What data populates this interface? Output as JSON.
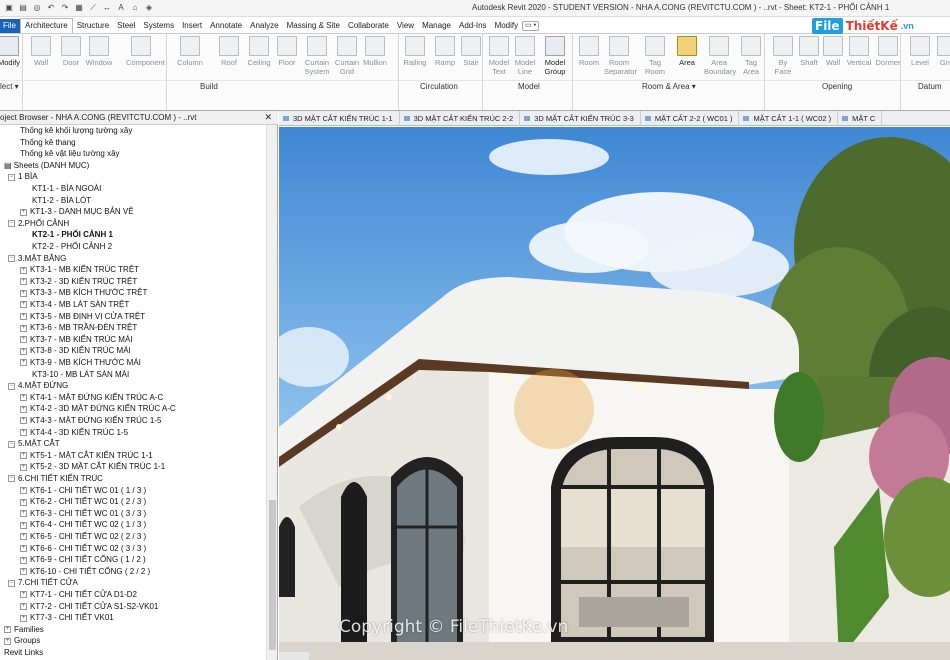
{
  "window": {
    "title": "Autodesk Revit 2020 - STUDENT VERSION - NHA A.CONG (REVITCTU.COM ) - ..rvt - Sheet: KT2-1 - PHỐI CẢNH 1"
  },
  "logo": {
    "file": "File",
    "name": "ThiếtKế",
    "vn": ".vn"
  },
  "ribbon_tabs": [
    {
      "label": "File"
    },
    {
      "label": "Architecture"
    },
    {
      "label": "Structure"
    },
    {
      "label": "Steel"
    },
    {
      "label": "Systems"
    },
    {
      "label": "Insert"
    },
    {
      "label": "Annotate"
    },
    {
      "label": "Analyze"
    },
    {
      "label": "Massing & Site"
    },
    {
      "label": "Collaborate"
    },
    {
      "label": "View"
    },
    {
      "label": "Manage"
    },
    {
      "label": "Add-Ins"
    },
    {
      "label": "Modify"
    },
    {
      "label": "▭ •"
    }
  ],
  "ribbon": {
    "tools": [
      {
        "l1": "Modify",
        "l2": "",
        "dark": true
      },
      {
        "l1": "Wall",
        "l2": ""
      },
      {
        "l1": "Door",
        "l2": ""
      },
      {
        "l1": "Window",
        "l2": ""
      },
      {
        "l1": "Component",
        "l2": ""
      },
      {
        "l1": "Column",
        "l2": ""
      },
      {
        "l1": "Roof",
        "l2": ""
      },
      {
        "l1": "Ceiling",
        "l2": ""
      },
      {
        "l1": "Floor",
        "l2": ""
      },
      {
        "l1": "Curtain",
        "l2": "System"
      },
      {
        "l1": "Curtain",
        "l2": "Grid"
      },
      {
        "l1": "Mullion",
        "l2": ""
      },
      {
        "l1": "Railing",
        "l2": ""
      },
      {
        "l1": "Ramp",
        "l2": ""
      },
      {
        "l1": "Stair",
        "l2": ""
      },
      {
        "l1": "Model",
        "l2": "Text"
      },
      {
        "l1": "Model",
        "l2": "Line"
      },
      {
        "l1": "Model",
        "l2": "Group",
        "dark": true
      },
      {
        "l1": "Room",
        "l2": ""
      },
      {
        "l1": "Room",
        "l2": "Separator"
      },
      {
        "l1": "Tag",
        "l2": "Room"
      },
      {
        "l1": "Area",
        "l2": "",
        "dark": true
      },
      {
        "l1": "Area",
        "l2": "Boundary"
      },
      {
        "l1": "Tag",
        "l2": "Area"
      },
      {
        "l1": "By",
        "l2": "Face"
      },
      {
        "l1": "Shaft",
        "l2": ""
      },
      {
        "l1": "Wall",
        "l2": ""
      },
      {
        "l1": "Vertical",
        "l2": ""
      },
      {
        "l1": "Dormer",
        "l2": ""
      },
      {
        "l1": "Level",
        "l2": ""
      },
      {
        "l1": "Grid",
        "l2": ""
      }
    ],
    "panels": [
      {
        "label": "lect ▾"
      },
      {
        "label": "Build"
      },
      {
        "label": "Circulation"
      },
      {
        "label": "Model"
      },
      {
        "label": "Room & Area ▾"
      },
      {
        "label": "Opening"
      },
      {
        "label": "Datum"
      }
    ]
  },
  "browser": {
    "title": "oject Browser - NHA A.CONG (REVITCTU.COM ) - ..rvt",
    "close": "✕",
    "rows": [
      {
        "text": "Thống kê khối lượng tường xây",
        "indent": 20,
        "exp": ""
      },
      {
        "text": "Thống kê thang",
        "indent": 20,
        "exp": ""
      },
      {
        "text": "Thống kê vật liệu tường xây",
        "indent": 20,
        "exp": ""
      },
      {
        "text": "Sheets (DANH MỤC)",
        "indent": 4,
        "exp": "",
        "icon": true
      },
      {
        "text": "1 BÌA",
        "indent": 8,
        "exp": "−"
      },
      {
        "text": "KT1-1 - BÌA NGOÀI",
        "indent": 32,
        "exp": ""
      },
      {
        "text": "KT1-2 - BÌA LÓT",
        "indent": 32,
        "exp": ""
      },
      {
        "text": "KT1-3 - DANH MỤC BẢN VẼ",
        "indent": 20,
        "exp": "+"
      },
      {
        "text": "2.PHỐI CẢNH",
        "indent": 8,
        "exp": "−"
      },
      {
        "text": "KT2-1 - PHỐI CẢNH 1",
        "indent": 32,
        "exp": "",
        "sel": true
      },
      {
        "text": "KT2-2 - PHỐI CẢNH 2",
        "indent": 32,
        "exp": ""
      },
      {
        "text": "3.MẶT BẰNG",
        "indent": 8,
        "exp": "−"
      },
      {
        "text": "KT3-1 - MB KIẾN TRÚC TRỆT",
        "indent": 20,
        "exp": "+"
      },
      {
        "text": "KT3-2 - 3D KIẾN TRÚC TRỆT",
        "indent": 20,
        "exp": "+"
      },
      {
        "text": "KT3-3 - MB KÍCH THƯỚC TRỆT",
        "indent": 20,
        "exp": "+"
      },
      {
        "text": "KT3-4 - MB LÁT SÀN TRỆT",
        "indent": 20,
        "exp": "+"
      },
      {
        "text": "KT3-5 - MB ĐỊNH VỊ CỬA TRỆT",
        "indent": 20,
        "exp": "+"
      },
      {
        "text": "KT3-6 - MB TRẦN-ĐÈN TRỆT",
        "indent": 20,
        "exp": "+"
      },
      {
        "text": "KT3-7 - MB KIẾN TRÚC MÁI",
        "indent": 20,
        "exp": "+"
      },
      {
        "text": "KT3-8 - 3D KIẾN TRÚC MÁI",
        "indent": 20,
        "exp": "+"
      },
      {
        "text": "KT3-9 - MB KÍCH THƯỚC MÁI",
        "indent": 20,
        "exp": "+"
      },
      {
        "text": "KT3-10 - MB LÁT SÀN MÁI",
        "indent": 32,
        "exp": ""
      },
      {
        "text": "4.MẶT ĐỨNG",
        "indent": 8,
        "exp": "−"
      },
      {
        "text": "KT4-1 - MẶT ĐỨNG KIẾN TRÚC A-C",
        "indent": 20,
        "exp": "+"
      },
      {
        "text": "KT4-2 - 3D MẶT ĐỨNG KIẾN TRÚC A-C",
        "indent": 20,
        "exp": "+"
      },
      {
        "text": "KT4-3 - MẶT ĐỨNG KIẾN TRÚC 1-5",
        "indent": 20,
        "exp": "+"
      },
      {
        "text": "KT4-4 - 3D KIẾN TRÚC 1-5",
        "indent": 20,
        "exp": "+"
      },
      {
        "text": "5.MẶT CẮT",
        "indent": 8,
        "exp": "−"
      },
      {
        "text": "KT5-1 - MẶT CẮT KIẾN TRÚC 1-1",
        "indent": 20,
        "exp": "+"
      },
      {
        "text": "KT5-2 - 3D MẶT CẮT KIẾN TRÚC 1-1",
        "indent": 20,
        "exp": "+"
      },
      {
        "text": "6.CHI TIẾT KIẾN TRÚC",
        "indent": 8,
        "exp": "−"
      },
      {
        "text": "KT6-1 - CHI TIẾT WC 01 ( 1 / 3 )",
        "indent": 20,
        "exp": "+"
      },
      {
        "text": "KT6-2 - CHI TIẾT WC 01 ( 2 / 3 )",
        "indent": 20,
        "exp": "+"
      },
      {
        "text": "KT6-3 - CHI TIẾT WC 01 ( 3 / 3 )",
        "indent": 20,
        "exp": "+"
      },
      {
        "text": "KT6-4 - CHI TIẾT WC 02 ( 1 / 3 )",
        "indent": 20,
        "exp": "+"
      },
      {
        "text": "KT6-5 - CHI TIẾT WC 02 ( 2 / 3 )",
        "indent": 20,
        "exp": "+"
      },
      {
        "text": "KT6-6 - CHI TIẾT WC 02 ( 3 / 3 )",
        "indent": 20,
        "exp": "+"
      },
      {
        "text": "KT6-9 - CHI TIẾT CỔNG ( 1 / 2 )",
        "indent": 20,
        "exp": "+"
      },
      {
        "text": "KT6-10 - CHI TIẾT CỔNG ( 2 / 2 )",
        "indent": 20,
        "exp": "+"
      },
      {
        "text": "7.CHI TIẾT CỬA",
        "indent": 8,
        "exp": "−"
      },
      {
        "text": "KT7-1 - CHI TIẾT CỬA D1-D2",
        "indent": 20,
        "exp": "+"
      },
      {
        "text": "KT7-2 - CHI TIẾT CỬA S1-S2-VK01",
        "indent": 20,
        "exp": "+"
      },
      {
        "text": "KT7-3 - CHI TIẾT VK01",
        "indent": 20,
        "exp": "+"
      },
      {
        "text": "Families",
        "indent": 4,
        "exp": "+"
      },
      {
        "text": "Groups",
        "indent": 4,
        "exp": "+"
      },
      {
        "text": "Revit Links",
        "indent": 4,
        "exp": ""
      }
    ]
  },
  "view_tabs": [
    {
      "label": "3D MẶT CẮT KIẾN TRÚC 1-1"
    },
    {
      "label": "3D MẶT CẮT KIẾN TRÚC 2-2"
    },
    {
      "label": "3D MẶT CẮT KIẾN TRÚC 3-3"
    },
    {
      "label": "MẶT CẮT 2-2 ( WC01 )"
    },
    {
      "label": "MẶT CẮT 1-1 ( WC02 )"
    },
    {
      "label": "MẶT C"
    }
  ],
  "watermark": {
    "copyright": "Copyright © FileThietKe.vn"
  },
  "colors": {
    "file_tab": "#1a62b8",
    "area_highlight": "#f1d27a"
  }
}
